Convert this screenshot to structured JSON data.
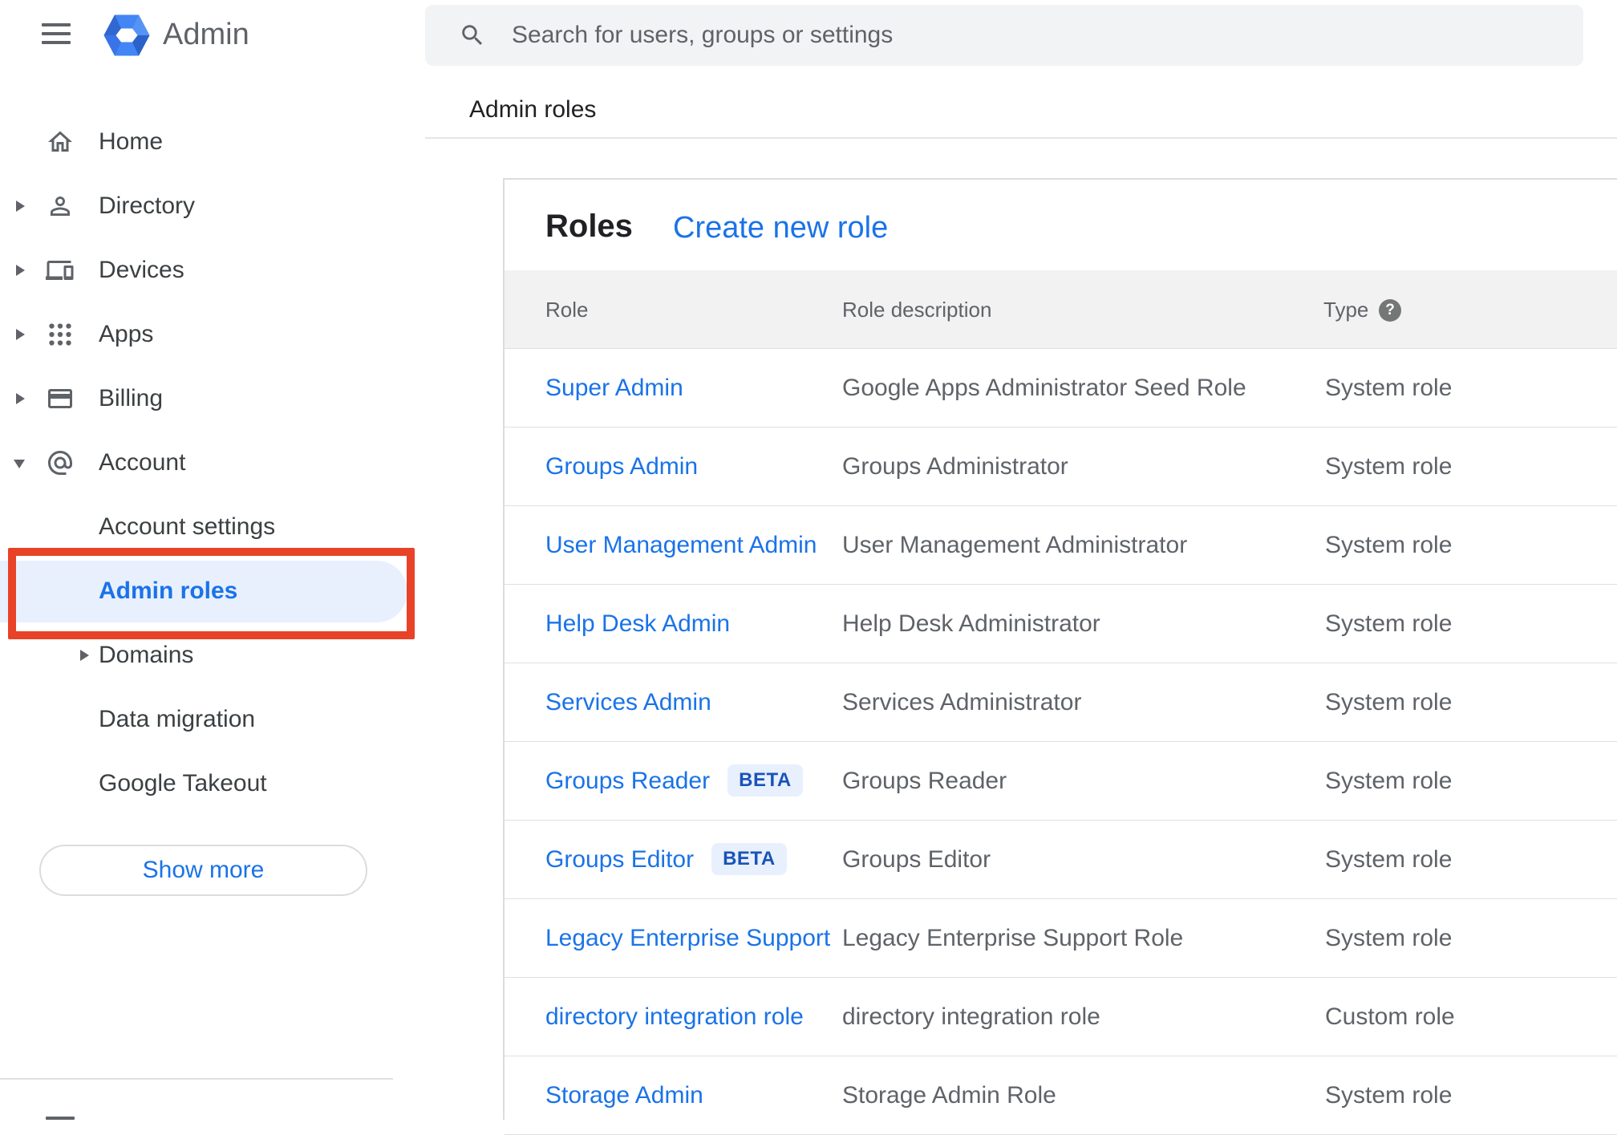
{
  "app": {
    "name": "Admin"
  },
  "search": {
    "placeholder": "Search for users, groups or settings"
  },
  "page": {
    "breadcrumb_title": "Admin roles"
  },
  "sidebar": {
    "items": [
      {
        "label": "Home",
        "icon": "home",
        "level": "main"
      },
      {
        "label": "Directory",
        "icon": "directory",
        "level": "main",
        "expandable": true
      },
      {
        "label": "Devices",
        "icon": "devices",
        "level": "main",
        "expandable": true
      },
      {
        "label": "Apps",
        "icon": "apps",
        "level": "main",
        "expandable": true
      },
      {
        "label": "Billing",
        "icon": "billing",
        "level": "main",
        "expandable": true
      },
      {
        "label": "Account",
        "icon": "account",
        "level": "main",
        "expandable": true,
        "expanded": true
      },
      {
        "label": "Account settings",
        "level": "sub"
      },
      {
        "label": "Admin roles",
        "level": "sub",
        "active": true,
        "annotated": true
      },
      {
        "label": "Domains",
        "level": "sub",
        "expandable": true
      },
      {
        "label": "Data migration",
        "level": "sub"
      },
      {
        "label": "Google Takeout",
        "level": "sub"
      }
    ],
    "show_more_label": "Show more"
  },
  "annotation": {
    "shape": "red-box",
    "color": "#e84228",
    "target": "Admin roles"
  },
  "roles_card": {
    "title": "Roles",
    "create_link_label": "Create new role",
    "columns": [
      "Role",
      "Role description",
      "Type"
    ],
    "type_help_glyph": "?",
    "beta_label": "BETA",
    "rows": [
      {
        "role": "Super Admin",
        "description": "Google Apps Administrator Seed Role",
        "type": "System role"
      },
      {
        "role": "Groups Admin",
        "description": "Groups Administrator",
        "type": "System role"
      },
      {
        "role": "User Management Admin",
        "description": "User Management Administrator",
        "type": "System role"
      },
      {
        "role": "Help Desk Admin",
        "description": "Help Desk Administrator",
        "type": "System role"
      },
      {
        "role": "Services Admin",
        "description": "Services Administrator",
        "type": "System role"
      },
      {
        "role": "Groups Reader",
        "beta": true,
        "description": "Groups Reader",
        "type": "System role"
      },
      {
        "role": "Groups Editor",
        "beta": true,
        "description": "Groups Editor",
        "type": "System role"
      },
      {
        "role": "Legacy Enterprise Support",
        "description": "Legacy Enterprise Support Role",
        "type": "System role"
      },
      {
        "role": "directory integration role",
        "description": "directory integration role",
        "type": "Custom role"
      },
      {
        "role": "Storage Admin",
        "description": "Storage Admin Role",
        "type": "System role"
      }
    ]
  },
  "colors": {
    "accent_blue": "#1a73e8",
    "link_blue": "#1a73e8",
    "active_bg": "#e8f0fe",
    "annotation_red": "#e84228",
    "table_header_bg": "#f2f2f2",
    "search_bg": "#f1f3f4",
    "text_primary": "#202124",
    "text_secondary": "#5f6368"
  }
}
